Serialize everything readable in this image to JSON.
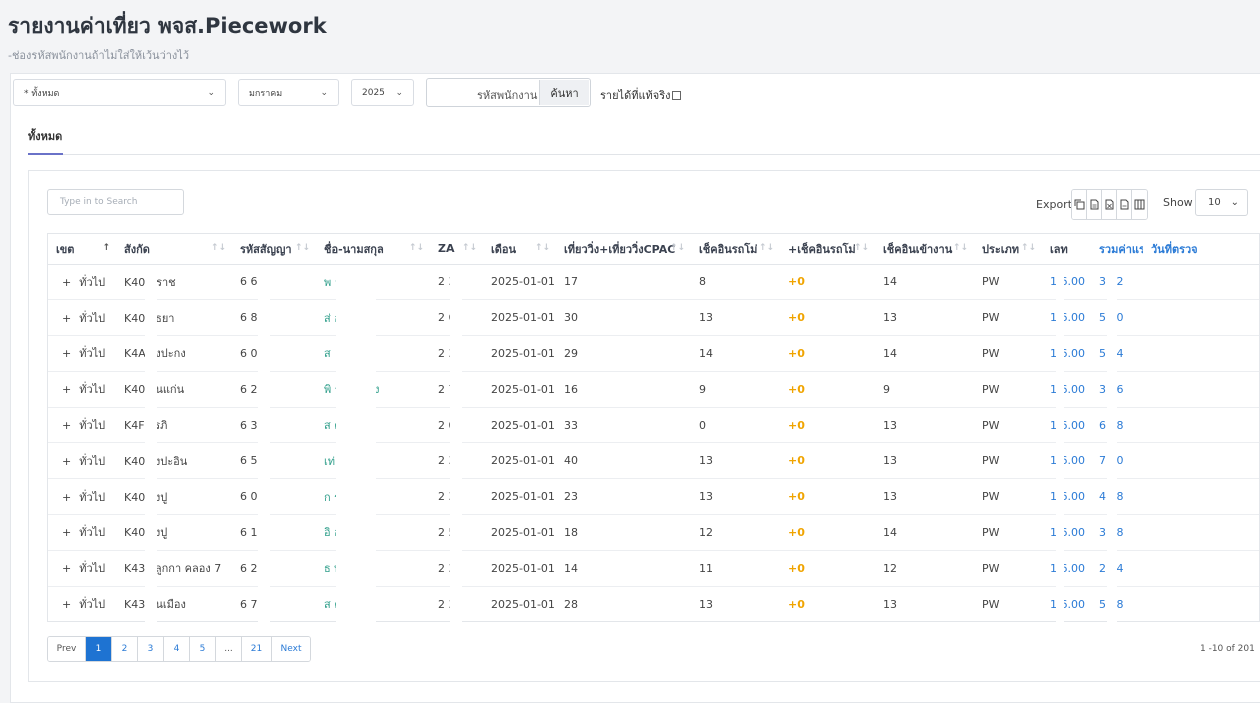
{
  "page": {
    "title": "รายงานค่าเที่ยว พจส.Piecework",
    "subtitle": "-ช่องรหัสพนักงานถ้าไม่ใส่ให้เว้นว่างไว้"
  },
  "filters": {
    "division_value": "* ทั้งหมด",
    "month_value": "มกราคม",
    "year_value": "2025",
    "employee_placeholder": "รหัสพนักงาน",
    "search_button": "ค้นหา",
    "actual_income_label": "รายได้ที่แท้จริง",
    "actual_income_checked": false
  },
  "tabs": [
    {
      "label": "ทั้งหมด",
      "active": true
    }
  ],
  "table_tools": {
    "search_placeholder": "Type in to Search",
    "export_label": "Export",
    "export_icons": [
      "copy-icon",
      "csv-icon",
      "excel-icon",
      "pdf-icon",
      "columns-icon"
    ],
    "show_label": "Show",
    "page_size": "10"
  },
  "table": {
    "columns": [
      "เขต",
      "สังกัด",
      "รหัสสัญญา",
      "ชื่อ-นามสกุล",
      "ZA",
      "เดือน",
      "เที่ยววิ่ง+เที่ยววิ่งCPAC",
      "เช็คอินรถโม่",
      "+เช็คอินรถโม่",
      "เช็คอินเข้างาน",
      "ประเภท",
      "เลท",
      "รวมค่าแรง",
      "วันที่ตรวจ"
    ],
    "rows": [
      {
        "zone": "ทั่วไป",
        "unit": "K40  คราช",
        "contract": "6      6",
        "name": "พ              าง",
        "za": "2      30",
        "month": "2025-01-01",
        "trips": "17",
        "checkin_mixer": "8",
        "checkin_mixer_plus": "+0",
        "checkin_work": "14",
        "type": "PW",
        "late": "1  6.00",
        "total": "3    62",
        "check_date": ""
      },
      {
        "zone": "ทั่วไป",
        "unit": "K40  ยุธยา",
        "contract": "6      8",
        "name": "ส่              อภาร",
        "za": "2      63",
        "month": "2025-01-01",
        "trips": "30",
        "checkin_mixer": "13",
        "checkin_mixer_plus": "+0",
        "checkin_work": "13",
        "type": "PW",
        "late": "1  6.00",
        "total": "5    30",
        "check_date": ""
      },
      {
        "zone": "ทั่วไป",
        "unit": "K4A  างปะกง",
        "contract": "6      0",
        "name": "ส",
        "za": "2      35",
        "month": "2025-01-01",
        "trips": "29",
        "checkin_mixer": "14",
        "checkin_mixer_plus": "+0",
        "checkin_work": "14",
        "type": "PW",
        "late": "1  6.00",
        "total": "5    34",
        "check_date": ""
      },
      {
        "zone": "ทั่วไป",
        "unit": "K40  อนแก่น",
        "contract": "6      2",
        "name": "พิ              รูก้านตรง",
        "za": "2      71",
        "month": "2025-01-01",
        "trips": "16",
        "checkin_mixer": "9",
        "checkin_mixer_plus": "+0",
        "checkin_work": "9",
        "type": "PW",
        "late": "1  6.00",
        "total": "3    66",
        "check_date": ""
      },
      {
        "zone": "ทั่วไป",
        "unit": "K4F  ารภิ",
        "contract": "6      3",
        "name": "ส              ตา",
        "za": "2      05",
        "month": "2025-01-01",
        "trips": "33",
        "checkin_mixer": "0",
        "checkin_mixer_plus": "+0",
        "checkin_work": "13",
        "type": "PW",
        "late": "1  6.00",
        "total": "6    58",
        "check_date": ""
      },
      {
        "zone": "ทั่วไป",
        "unit": "K40  างปะอิน",
        "contract": "6      5",
        "name": "เท่",
        "za": "2      31",
        "month": "2025-01-01",
        "trips": "40",
        "checkin_mixer": "13",
        "checkin_mixer_plus": "+0",
        "checkin_work": "13",
        "type": "PW",
        "late": "1  6.00",
        "total": "7    30",
        "check_date": ""
      },
      {
        "zone": "ทั่วไป",
        "unit": "K40  างปู",
        "contract": "6      0",
        "name": "ก              รา",
        "za": "2      35",
        "month": "2025-01-01",
        "trips": "23",
        "checkin_mixer": "13",
        "checkin_mixer_plus": "+0",
        "checkin_work": "13",
        "type": "PW",
        "late": "1  6.00",
        "total": "4    38",
        "check_date": ""
      },
      {
        "zone": "ทั่วไป",
        "unit": "K40  างปู",
        "contract": "6      1",
        "name": "อิ              อน",
        "za": "2      52",
        "month": "2025-01-01",
        "trips": "18",
        "checkin_mixer": "12",
        "checkin_mixer_plus": "+0",
        "checkin_work": "14",
        "type": "PW",
        "late": "1  6.00",
        "total": "3    28",
        "check_date": ""
      },
      {
        "zone": "ทั่วไป",
        "unit": "K43  าลูกกา คลอง 7",
        "contract": "6      2",
        "name": "ธ              ษย์",
        "za": "2      33",
        "month": "2025-01-01",
        "trips": "14",
        "checkin_mixer": "11",
        "checkin_mixer_plus": "+0",
        "checkin_work": "12",
        "type": "PW",
        "late": "1  6.00",
        "total": "2    34",
        "check_date": ""
      },
      {
        "zone": "ทั่วไป",
        "unit": "K43  อนเมือง",
        "contract": "6      7",
        "name": "ส              คำ",
        "za": "2      34",
        "month": "2025-01-01",
        "trips": "28",
        "checkin_mixer": "13",
        "checkin_mixer_plus": "+0",
        "checkin_work": "13",
        "type": "PW",
        "late": "1  6.00",
        "total": "5    58",
        "check_date": ""
      }
    ]
  },
  "pagination": {
    "prev": "Prev",
    "pages": [
      "1",
      "2",
      "3",
      "4",
      "5",
      "...",
      "21"
    ],
    "active": "1",
    "next": "Next",
    "summary": "1 -10 of 201"
  }
}
